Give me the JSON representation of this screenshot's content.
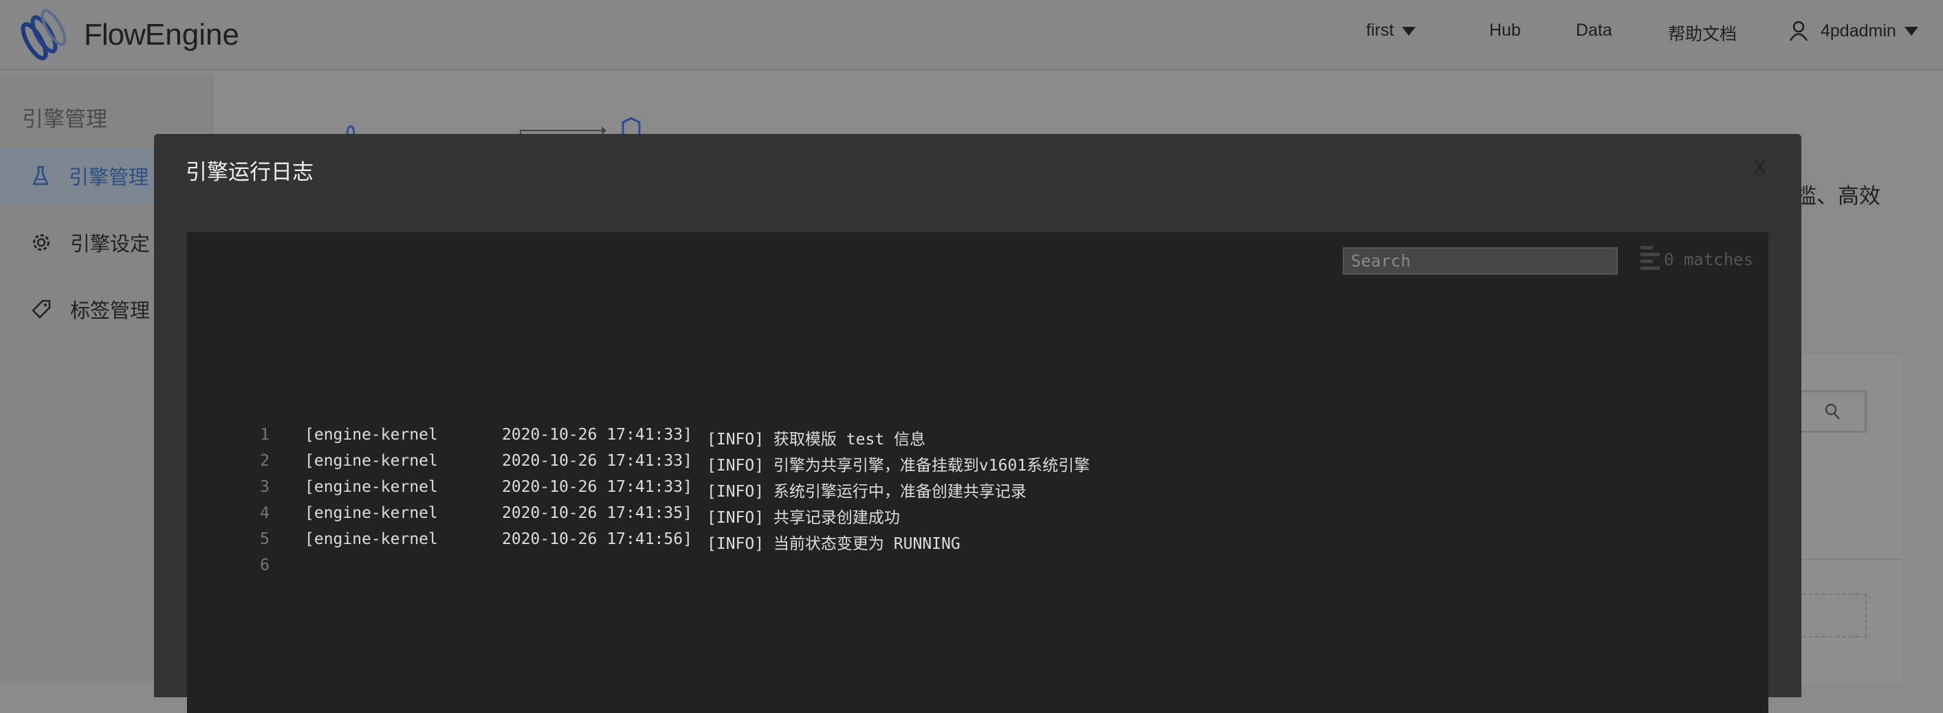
{
  "header": {
    "brand_part1": "Flow",
    "brand_part2": "Engine",
    "nav": [
      "first",
      "Hub",
      "Data",
      "帮助文档"
    ],
    "user": "4pdadmin"
  },
  "sidebar": {
    "title": "引擎管理",
    "items": [
      {
        "label": "引擎管理",
        "icon": "flask-icon",
        "active": true
      },
      {
        "label": "引擎设定",
        "icon": "gear-icon"
      },
      {
        "label": "标签管理",
        "icon": "tag-icon"
      }
    ]
  },
  "background": {
    "text_fragment": "门槛、高效"
  },
  "modal": {
    "title": "引擎运行日志",
    "close": "X",
    "search_placeholder": "Search",
    "matches": "0 matches",
    "lines": [
      {
        "no": "1",
        "source": "[engine-kernel",
        "time": "2020-10-26 17:41:33]",
        "msg": "[INFO] 获取模版 test 信息"
      },
      {
        "no": "2",
        "source": "[engine-kernel",
        "time": "2020-10-26 17:41:33]",
        "msg": "[INFO] 引擎为共享引擎，准备挂载到v1601系统引擎"
      },
      {
        "no": "3",
        "source": "[engine-kernel",
        "time": "2020-10-26 17:41:33]",
        "msg": "[INFO] 系统引擎运行中，准备创建共享记录"
      },
      {
        "no": "4",
        "source": "[engine-kernel",
        "time": "2020-10-26 17:41:35]",
        "msg": "[INFO] 共享记录创建成功"
      },
      {
        "no": "5",
        "source": "[engine-kernel",
        "time": "2020-10-26 17:41:56]",
        "msg": "[INFO] 当前状态变更为 RUNNING"
      },
      {
        "no": "6",
        "source": "",
        "time": "",
        "msg": ""
      }
    ]
  },
  "colors": {
    "brand": "#2a4a9a",
    "modal_bg": "#333333",
    "log_bg": "#222222"
  }
}
